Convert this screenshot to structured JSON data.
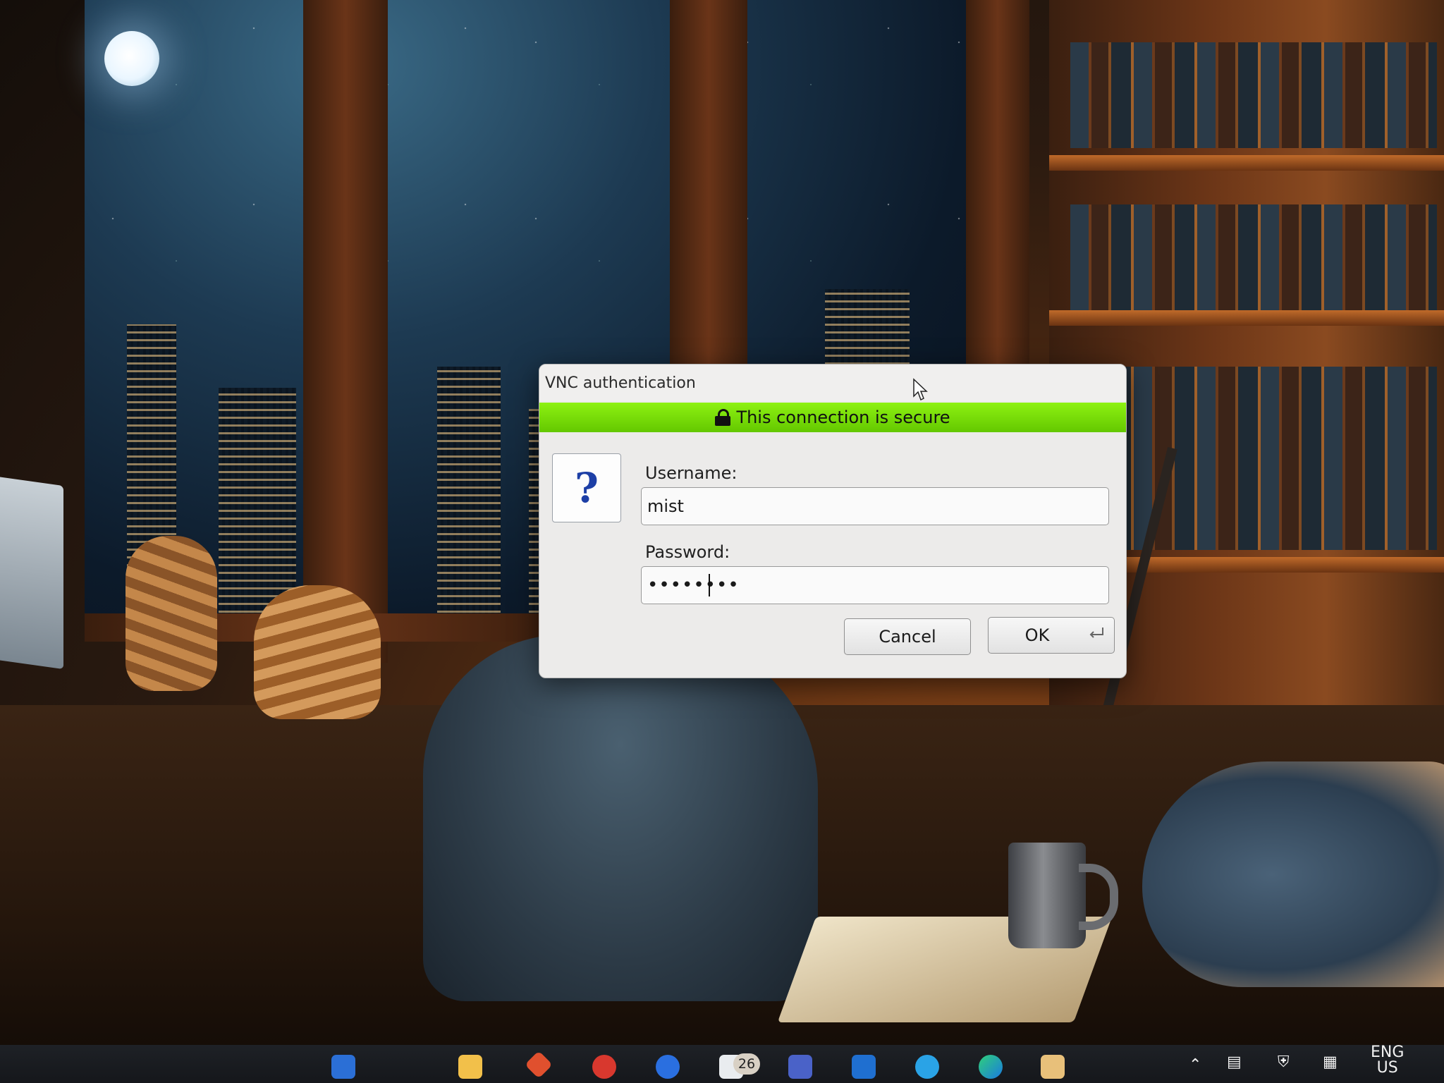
{
  "dialog": {
    "title": "VNC authentication",
    "secure_message": "This connection is secure",
    "question_mark": "?",
    "username_label": "Username:",
    "username_value": "mist",
    "password_label": "Password:",
    "password_value": "••••••••",
    "cancel_label": "Cancel",
    "ok_label": "OK"
  },
  "taskbar": {
    "notification_count": "26",
    "language_line1": "ENG",
    "language_line2": "US",
    "icons": [
      "file-explorer-icon",
      "calendar-icon",
      "store-icon",
      "browser-icon",
      "mail-icon",
      "outlook-icon",
      "edge-icon"
    ]
  },
  "colors": {
    "secure_bar": "#7ee00a",
    "dialog_bg": "#ecebea",
    "question_mark": "#1d3fa6"
  }
}
